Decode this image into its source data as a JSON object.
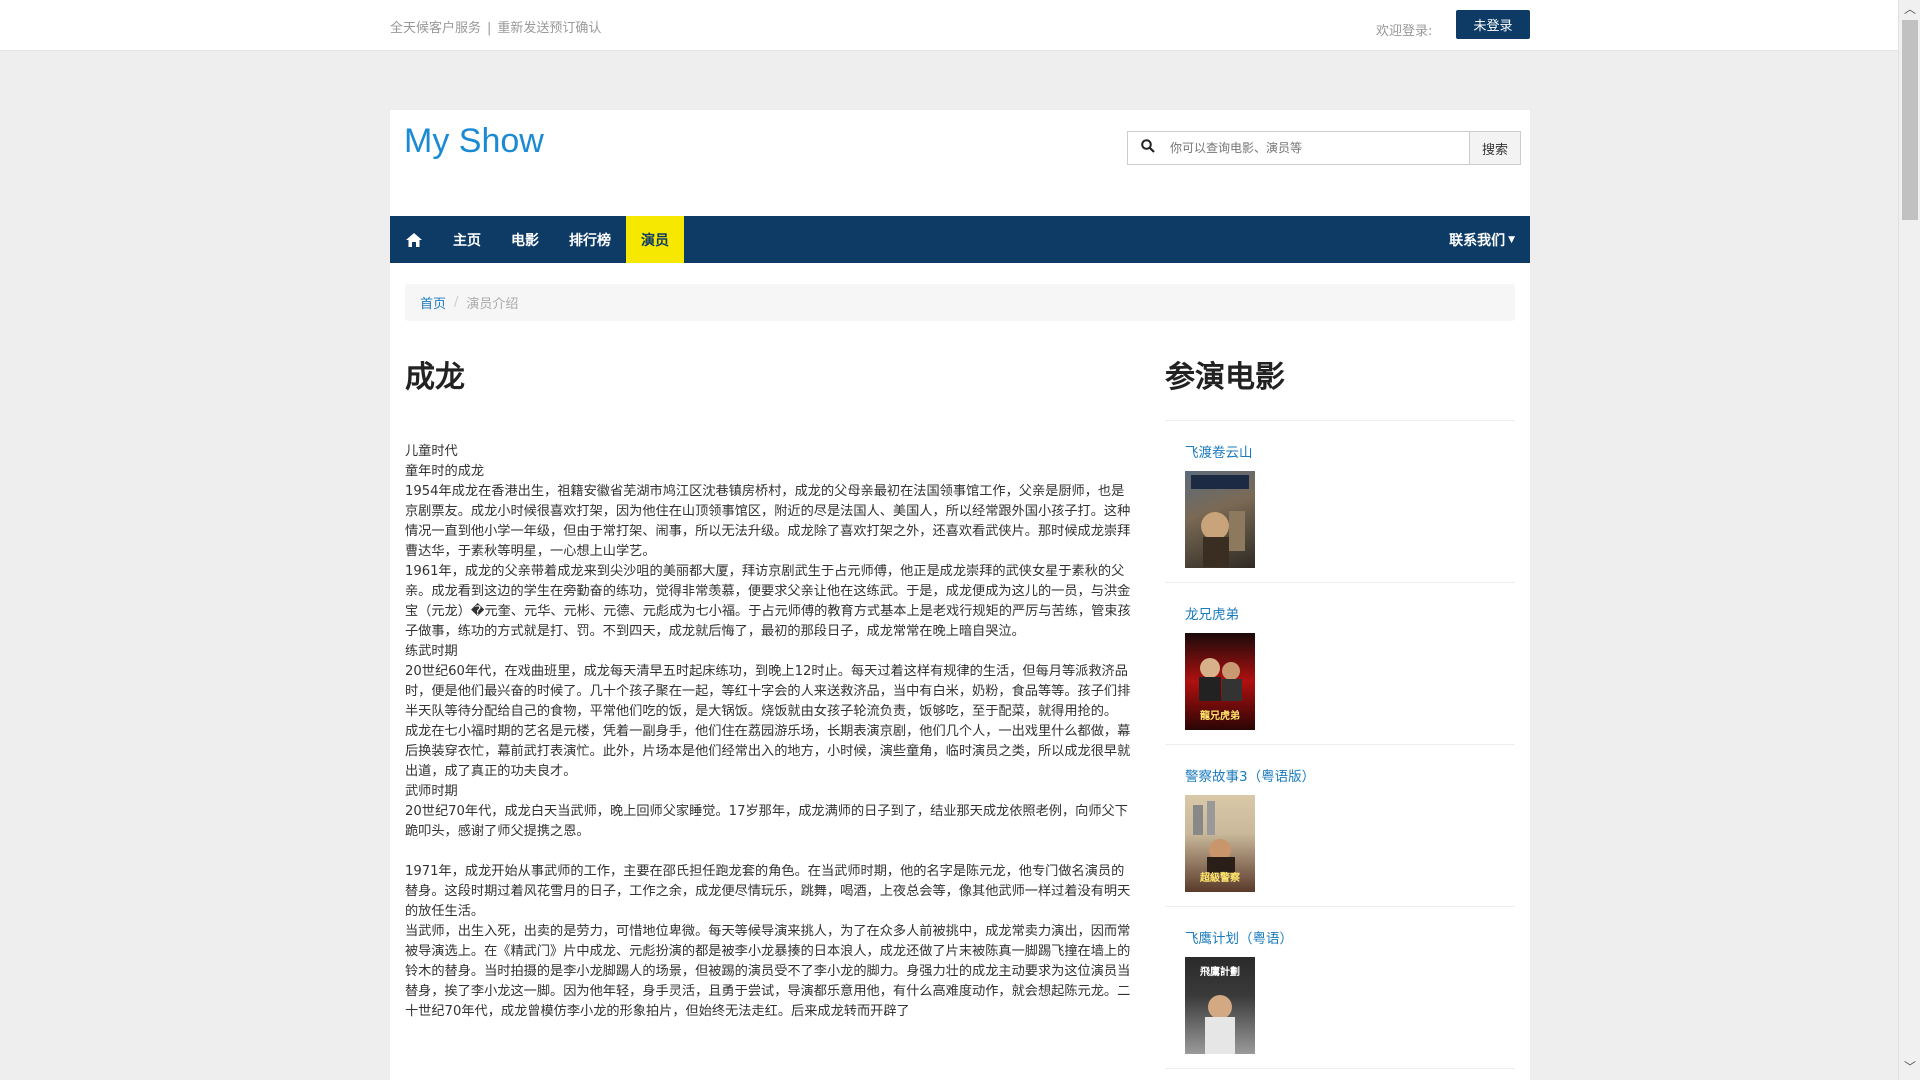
{
  "topbar": {
    "service_link": "全天候客户服务",
    "resend_link": "重新发送预订确认",
    "welcome": "欢迎登录:",
    "login_button": "未登录"
  },
  "header": {
    "brand": "My Show",
    "search_placeholder": "你可以查询电影、演员等",
    "search_button": "搜索"
  },
  "nav": {
    "items": [
      {
        "label": "主页"
      },
      {
        "label": "电影"
      },
      {
        "label": "排行榜"
      },
      {
        "label": "演员"
      }
    ],
    "active": "演员",
    "contact": "联系我们",
    "accent": "#0d3b66",
    "highlight": "#f6e800"
  },
  "breadcrumb": {
    "home": "首页",
    "current": "演员介绍"
  },
  "actor": {
    "name": "成龙",
    "paragraphs": [
      "儿童时代",
      "童年时的成龙",
      "1954年成龙在香港出生，祖籍安徽省芜湖市鸠江区沈巷镇房桥村，成龙的父母亲最初在法国领事馆工作，父亲是厨师，也是京剧票友。成龙小时候很喜欢打架，因为他住在山顶领事馆区，附近的尽是法国人、美国人，所以经常跟外国小孩子打。这种情况一直到他小学一年级，但由于常打架、闹事，所以无法升级。成龙除了喜欢打架之外，还喜欢看武侠片。那时候成龙崇拜曹达华，于素秋等明星，一心想上山学艺。",
      "1961年，成龙的父亲带着成龙来到尖沙咀的美丽都大厦，拜访京剧武生于占元师傅，他正是成龙崇拜的武侠女星于素秋的父亲。成龙看到这边的学生在旁勤奋的练功，觉得非常羡慕，便要求父亲让他在这练武。于是，成龙便成为这儿的一员，与洪金宝（元龙）�元奎、元华、元彬、元德、元彪成为七小福。于占元师傅的教育方式基本上是老戏行规矩的严厉与苦练，管束孩子做事，练功的方式就是打、罚。不到四天，成龙就后悔了，最初的那段日子，成龙常常在晚上暗自哭泣。",
      "练武时期",
      "20世纪60年代，在戏曲班里，成龙每天清早五时起床练功，到晚上12时止。每天过着这样有规律的生活，但每月等派救济品时，便是他们最兴奋的时候了。几十个孩子聚在一起，等红十字会的人来送救济品，当中有白米，奶粉，食品等等。孩子们排半天队等待分配给自己的食物，平常他们吃的饭，是大锅饭。烧饭就由女孩子轮流负责，饭够吃，至于配菜，就得用抢的。",
      "成龙在七小福时期的艺名是元楼，凭着一副身手，他们住在荔园游乐场，长期表演京剧，他们几个人，一出戏里什么都做，幕后换装穿衣忙，幕前武打表演忙。此外，片场本是他们经常出入的地方，小时候，演些童角，临时演员之类，所以成龙很早就出道，成了真正的功夫良才。",
      "武师时期",
      "20世纪70年代，成龙白天当武师，晚上回师父家睡觉。17岁那年，成龙满师的日子到了，结业那天成龙依照老例，向师父下跪叩头，感谢了师父提携之恩。",
      "",
      "1971年，成龙开始从事武师的工作，主要在邵氏担任跑龙套的角色。在当武师时期，他的名字是陈元龙，他专门做名演员的替身。这段时期过着风花雪月的日子，工作之余，成龙便尽情玩乐，跳舞，喝酒，上夜总会等，像其他武师一样过着没有明天的放任生活。",
      "当武师，出生入死，出卖的是劳力，可惜地位卑微。每天等候导演来挑人，为了在众多人前被挑中，成龙常卖力演出，因而常被导演选上。在《精武门》片中成龙、元彪扮演的都是被李小龙暴揍的日本浪人，成龙还做了片末被陈真一脚踢飞撞在墙上的铃木的替身。当时拍摄的是李小龙脚踢人的场景，但被踢的演员受不了李小龙的脚力。身强力壮的成龙主动要求为这位演员当替身，挨了李小龙这一脚。因为他年轻，身手灵活，且勇于尝试，导演都乐意用他，有什么高难度动作，就会想起陈元龙。二十世纪70年代，成龙曾模仿李小龙的形象拍片，但始终无法走红。后来成龙转而开辟了"
    ]
  },
  "films": {
    "title": "参演电影",
    "items": [
      {
        "title": "飞渡卷云山",
        "poster_colors": [
          "#7a6a55",
          "#2f2a24"
        ],
        "poster_text": ""
      },
      {
        "title": "龙兄虎弟",
        "poster_colors": [
          "#b01010",
          "#2a0505"
        ],
        "poster_text": "龍兄虎弟"
      },
      {
        "title": "警察故事3（粤语版）",
        "poster_colors": [
          "#c9b89a",
          "#5a3a2a"
        ],
        "poster_text": "超級警察"
      },
      {
        "title": "飞鹰计划（粤语）",
        "poster_colors": [
          "#3a3a3a",
          "#9a9a9a"
        ],
        "poster_text": "飛鷹計劃"
      }
    ]
  }
}
